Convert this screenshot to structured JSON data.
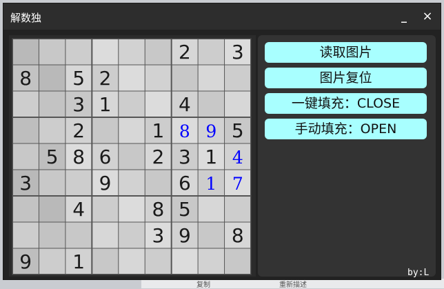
{
  "window": {
    "title": "解数独",
    "minimize_label": "_",
    "close_label": "×"
  },
  "buttons": {
    "read_image": "读取图片",
    "reset_image": "图片复位",
    "auto_fill": "一键填充：CLOSE",
    "manual_fill": "手动填充：OPEN"
  },
  "credit": "by:L",
  "background_peek": {
    "text_a": "复制",
    "text_b": "重新描述"
  },
  "colors": {
    "button_bg": "#a8ffff",
    "given_digit": "#1a1a1a",
    "filled_digit": "#0000ff"
  },
  "sudoku": {
    "cells": [
      [
        "",
        "",
        "",
        "",
        "",
        "",
        "2",
        "",
        "3"
      ],
      [
        "8",
        "",
        "5",
        "2",
        "",
        "",
        "",
        "",
        ""
      ],
      [
        "",
        "",
        "3",
        "1",
        "",
        "",
        "4",
        "",
        ""
      ],
      [
        "",
        "",
        "2",
        "",
        "",
        "1",
        "8",
        "9",
        "5"
      ],
      [
        "",
        "5",
        "8",
        "6",
        "",
        "2",
        "3",
        "1",
        "4"
      ],
      [
        "3",
        "",
        "",
        "9",
        "",
        "",
        "6",
        "1",
        "7"
      ],
      [
        "",
        "",
        "4",
        "",
        "",
        "8",
        "5",
        "",
        ""
      ],
      [
        "",
        "",
        "",
        "",
        "",
        "3",
        "9",
        "",
        "8"
      ],
      [
        "9",
        "",
        "1",
        "",
        "",
        "",
        "",
        "",
        ""
      ]
    ],
    "filled": [
      [
        3,
        6
      ],
      [
        3,
        7
      ],
      [
        4,
        8
      ],
      [
        5,
        7
      ],
      [
        5,
        8
      ]
    ]
  }
}
